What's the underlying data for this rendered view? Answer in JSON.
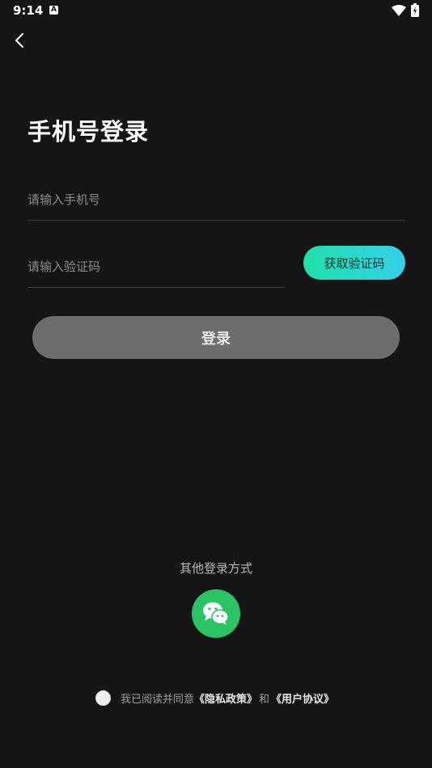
{
  "status_bar": {
    "time": "9:14",
    "notification_badge": "A"
  },
  "header": {
    "title": "手机号登录"
  },
  "form": {
    "phone_placeholder": "请输入手机号",
    "code_placeholder": "请输入验证码",
    "get_code_label": "获取验证码",
    "login_label": "登录"
  },
  "other_login": {
    "label": "其他登录方式",
    "icon": "wechat-icon"
  },
  "agreement": {
    "prefix": "我已阅读并同意",
    "privacy_link": "《隐私政策》",
    "and": "和",
    "terms_link": "《用户协议》",
    "checked": false
  },
  "colors": {
    "background": "#151515",
    "accent_start": "#1fe0a9",
    "accent_end": "#35d0ea",
    "login_disabled": "#6d6d6d",
    "wechat_green": "#2bc464"
  }
}
